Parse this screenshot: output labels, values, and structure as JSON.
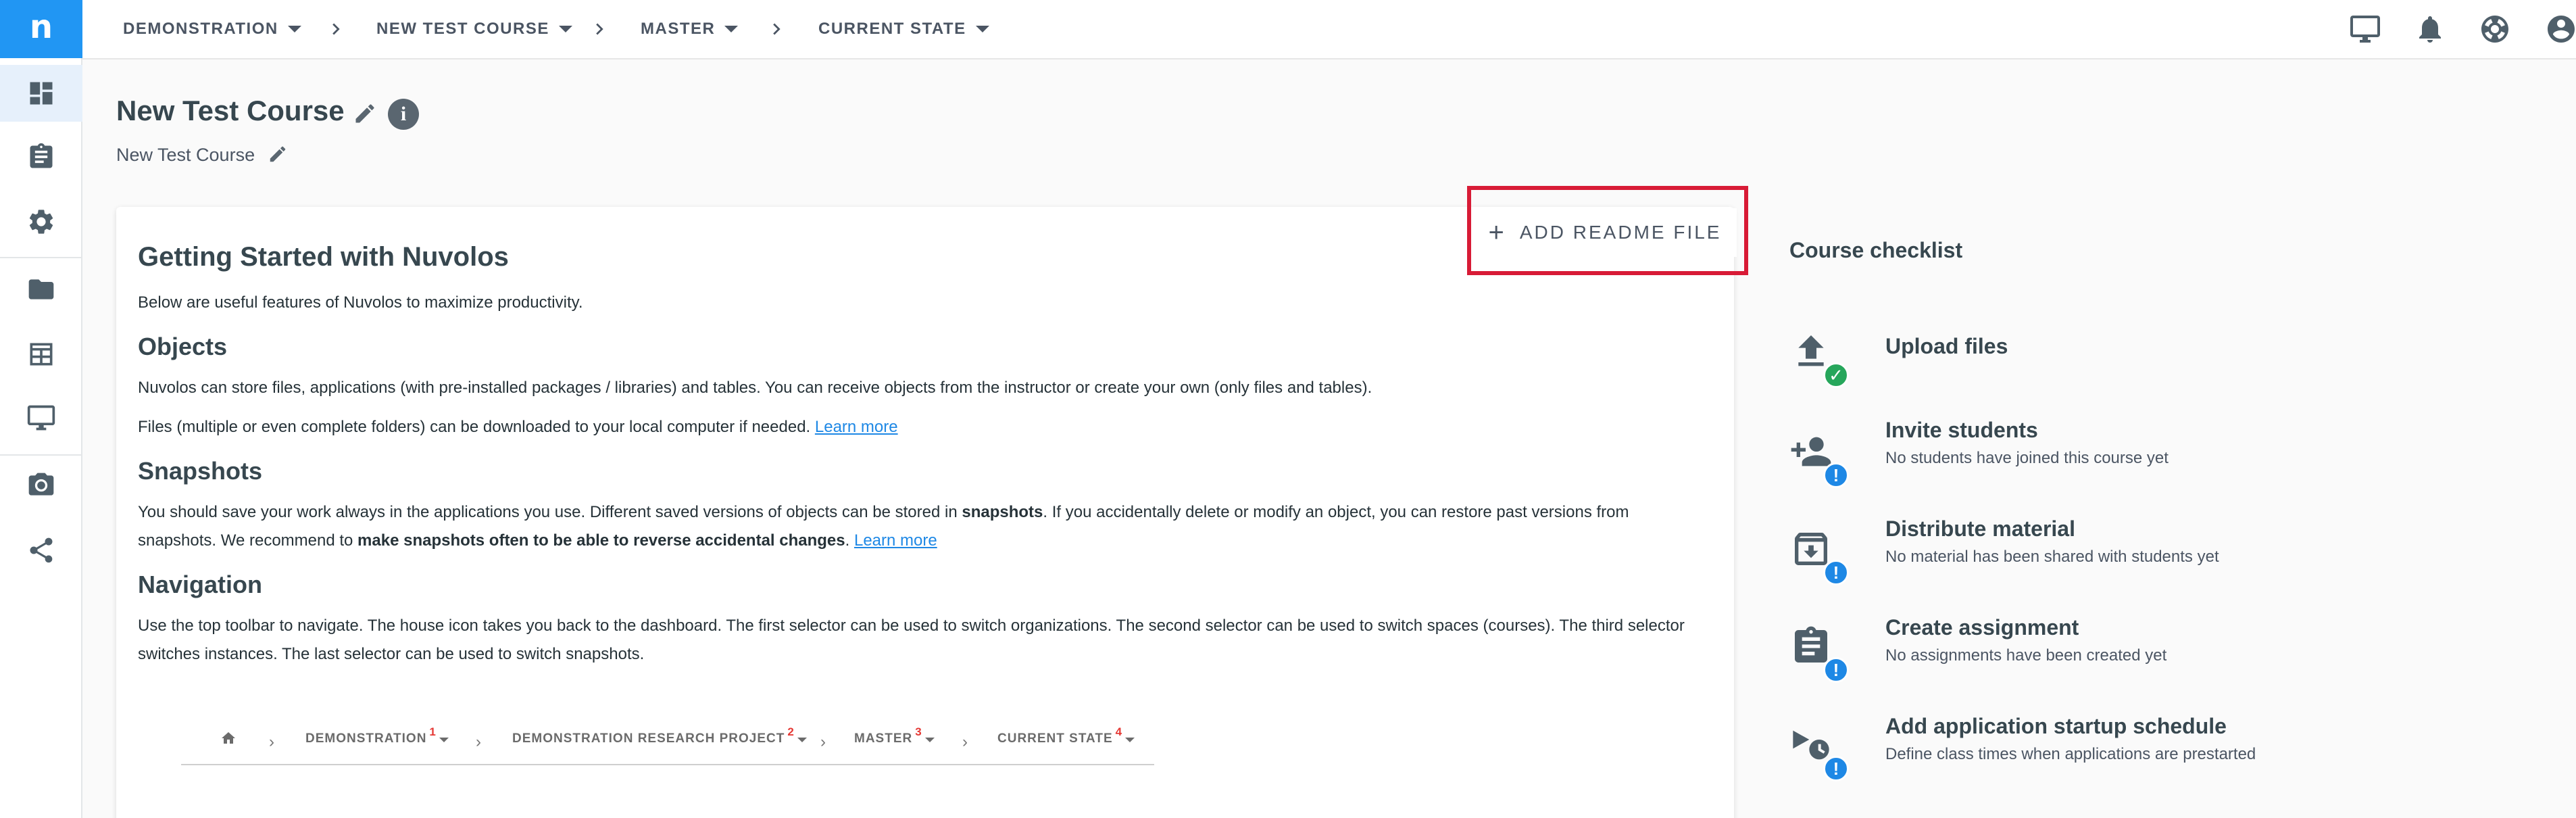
{
  "app": {
    "logo": "n"
  },
  "breadcrumb": {
    "org": "DEMONSTRATION",
    "space": "NEW TEST COURSE",
    "instance": "MASTER",
    "snapshot": "CURRENT STATE"
  },
  "rail": {
    "icons": [
      "dashboard-icon",
      "assignment-icon",
      "settings-icon",
      "folder-icon",
      "table-icon",
      "monitor-icon",
      "camera-icon",
      "share-icon"
    ]
  },
  "top_icons": [
    "monitor-icon",
    "bell-icon",
    "lifebuoy-icon",
    "account-icon"
  ],
  "header": {
    "title": "New Test Course",
    "subtitle": "New Test Course"
  },
  "readme": {
    "add_label": "ADD README FILE",
    "highlight_color": "#d81b36"
  },
  "content": {
    "heading": "Getting Started with Nuvolos",
    "intro": "Below are useful features of Nuvolos to maximize productivity.",
    "objects_heading": "Objects",
    "objects_p1": "Nuvolos can store files, applications (with pre-installed packages / libraries) and tables. You can receive objects from the instructor or create your own (only files and tables).",
    "objects_p2": "Files (multiple or even complete folders) can be downloaded to your local computer if needed.",
    "learn_more": "Learn more",
    "snapshots_heading": "Snapshots",
    "snap_p_a": "You should save your work always in the applications you use. Different saved versions of objects can be stored in ",
    "snap_bold_1": "snapshots",
    "snap_p_b": ". If you accidentally delete or modify an object, you can restore past versions from snapshots. We recommend to ",
    "snap_bold_2": "make snapshots often to be able to reverse accidental changes",
    "snap_p_c": ".",
    "navigation_heading": "Navigation",
    "nav_p": "Use the top toolbar to navigate. The house icon takes you back to the dashboard. The first selector can be used to switch organizations. The second selector can be used to switch spaces (courses). The third selector switches instances. The last selector can be used to switch snapshots.",
    "demo": {
      "org": "DEMONSTRATION",
      "org_num": "1",
      "space": "DEMONSTRATION RESEARCH PROJECT",
      "space_num": "2",
      "instance": "MASTER",
      "instance_num": "3",
      "snapshot": "CURRENT STATE",
      "snapshot_num": "4"
    }
  },
  "checklist": {
    "title": "Course checklist",
    "items": [
      {
        "title": "Upload files",
        "subtitle": "",
        "status": "done",
        "icon": "upload-icon"
      },
      {
        "title": "Invite students",
        "subtitle": "No students have joined this course yet",
        "status": "todo",
        "icon": "add-person-icon"
      },
      {
        "title": "Distribute material",
        "subtitle": "No material has been shared with students yet",
        "status": "todo",
        "icon": "archive-icon"
      },
      {
        "title": "Create assignment",
        "subtitle": "No assignments have been created yet",
        "status": "todo",
        "icon": "assignment-icon"
      },
      {
        "title": "Add application startup schedule",
        "subtitle": "Define class times when applications are prestarted",
        "status": "todo",
        "icon": "schedule-icon"
      }
    ]
  }
}
